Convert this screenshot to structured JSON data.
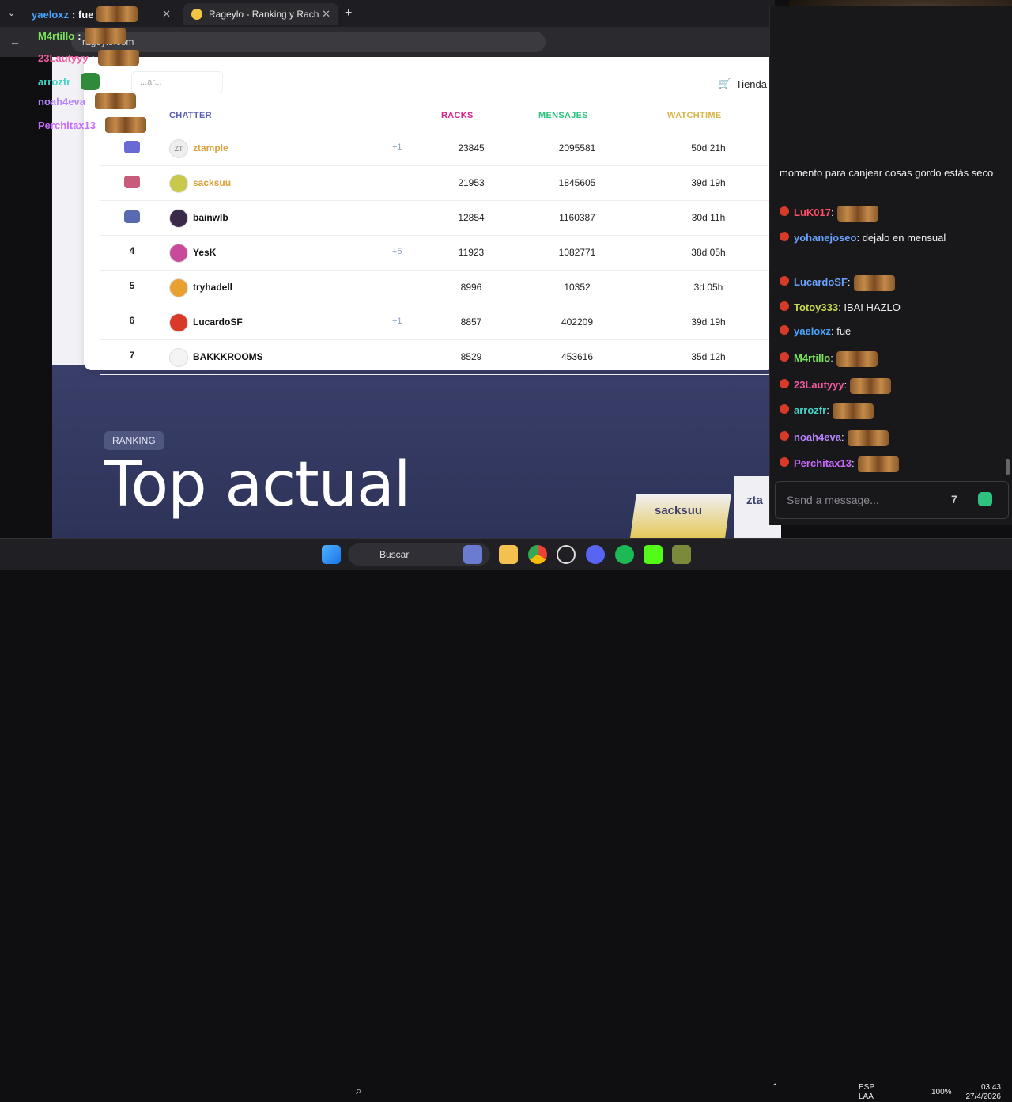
{
  "browser": {
    "tabs": [
      {
        "label": "Rageylo - Ranking y Racha de s",
        "active": true
      }
    ],
    "new_tab": "+",
    "url": "rageylo.com"
  },
  "page": {
    "shop_label": "Tienda",
    "search_placeholder": "...ar...",
    "table": {
      "headers": {
        "chatter": "CHATTER",
        "racks": "RACKS",
        "mensajes": "MENSAJES",
        "watchtime": "WATCHTIME"
      },
      "header_colors": {
        "chatter": "#5b5fb5",
        "racks": "#d4248a",
        "mensajes": "#2ec27e",
        "watchtime": "#d9b44a"
      },
      "rows": [
        {
          "rank": "",
          "icon": "crown-icon",
          "avatar": "ZT",
          "name": "ztample",
          "name_color": "#d9a23a",
          "boost": "+1",
          "racks": "23845",
          "mensajes": "2095581",
          "watchtime": "50d 21h"
        },
        {
          "rank": "",
          "icon": "flower-badge-icon",
          "avatar": "",
          "name": "sacksuu",
          "name_color": "#d9a23a",
          "boost": "",
          "racks": "21953",
          "mensajes": "1845605",
          "watchtime": "39d 19h"
        },
        {
          "rank": "",
          "icon": "gear-badge-icon",
          "avatar": "",
          "name": "bainwlb",
          "name_color": "#111111",
          "boost": "",
          "racks": "12854",
          "mensajes": "1160387",
          "watchtime": "30d 11h"
        },
        {
          "rank": "4",
          "icon": "",
          "avatar": "",
          "name": "YesK",
          "name_color": "#111111",
          "boost": "+5",
          "racks": "11923",
          "mensajes": "1082771",
          "watchtime": "38d 05h"
        },
        {
          "rank": "5",
          "icon": "",
          "avatar": "",
          "name": "tryhadell",
          "name_color": "#111111",
          "boost": "",
          "racks": "8996",
          "mensajes": "10352",
          "watchtime": "3d 05h"
        },
        {
          "rank": "6",
          "icon": "",
          "avatar": "",
          "name": "LucardoSF",
          "name_color": "#111111",
          "boost": "+1",
          "racks": "8857",
          "mensajes": "402209",
          "watchtime": "39d 19h"
        },
        {
          "rank": "7",
          "icon": "",
          "avatar": "",
          "name": "BAKKKROOMS",
          "name_color": "#111111",
          "boost": "",
          "racks": "8529",
          "mensajes": "453616",
          "watchtime": "35d 12h"
        }
      ]
    },
    "ranking_badge": "RANKING",
    "headline": "Top actual",
    "podium": [
      "sacksuu",
      "zta"
    ]
  },
  "overlay_chat": [
    {
      "user": "yaeloxz",
      "text": ": fue",
      "color": "#4aa3ff"
    },
    {
      "user": "M4rtillo",
      "text": ":",
      "color": "#7be35a"
    },
    {
      "user": "23Lautyyy",
      "text": ":",
      "color": "#f05aa0"
    },
    {
      "user": "arrozfr",
      "text": ":",
      "color": "#46d4c8"
    },
    {
      "user": "noah4eva",
      "text": ":",
      "color": "#b784ff"
    },
    {
      "user": "Perchitax13",
      "text": ":",
      "color": "#c86aff"
    }
  ],
  "chat": {
    "messages": [
      {
        "user": "",
        "text": "momento para canjear cosas gordo estás seco",
        "color": "#efeff1"
      },
      {
        "user": "LuK017",
        "text": ":",
        "color": "#ff4f6a"
      },
      {
        "user": "yohanejoseo",
        "text": ": dejalo en mensual",
        "color": "#6aa3ff"
      },
      {
        "user": "LucardoSF",
        "text": ":",
        "color": "#6aa3ff"
      },
      {
        "user": "Totoy333",
        "text": ": IBAI HAZLO",
        "color": "#c8d84a"
      },
      {
        "user": "yaeloxz",
        "text": ": fue",
        "color": "#4aa3ff"
      },
      {
        "user": "M4rtillo",
        "text": ":",
        "color": "#7be35a"
      },
      {
        "user": "23Lautyyy",
        "text": ":",
        "color": "#f05aa0"
      },
      {
        "user": "arrozfr",
        "text": ":",
        "color": "#46d4c8"
      },
      {
        "user": "noah4eva",
        "text": ":",
        "color": "#b784ff"
      },
      {
        "user": "Perchitax13",
        "text": ":",
        "color": "#c86aff"
      }
    ],
    "input_placeholder": "Send a message..."
  },
  "taskbar": {
    "search": "Buscar",
    "lang": "ESP",
    "lang2": "LAA",
    "battery": "100%",
    "time": "03:43",
    "date": "27/4/2026"
  }
}
